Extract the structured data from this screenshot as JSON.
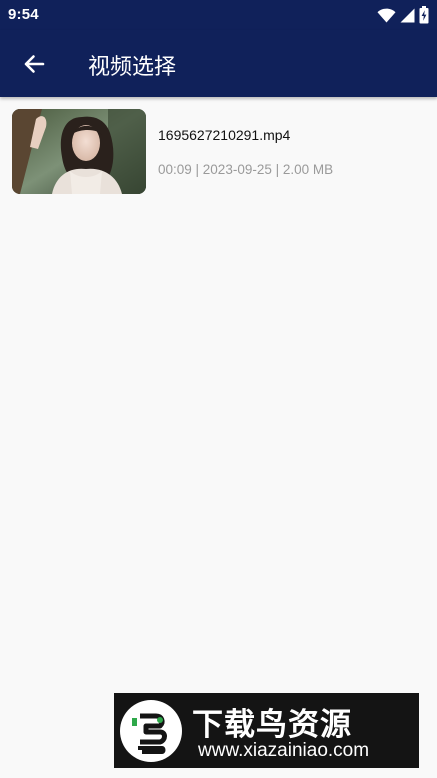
{
  "status_bar": {
    "time": "9:54",
    "icons": [
      "wifi-icon",
      "cell-signal-icon",
      "battery-charging-icon"
    ]
  },
  "header": {
    "back_icon": "arrow-left-icon",
    "title": "视频选择",
    "background": "#10215a"
  },
  "videos": [
    {
      "file_name": "1695627210291.mp4",
      "meta": "00:09 | 2023-09-25 | 2.00 MB",
      "thumbnail": "video-thumbnail"
    }
  ],
  "watermark": {
    "title": "下载鸟资源",
    "url": "www.xiazainiao.com"
  }
}
